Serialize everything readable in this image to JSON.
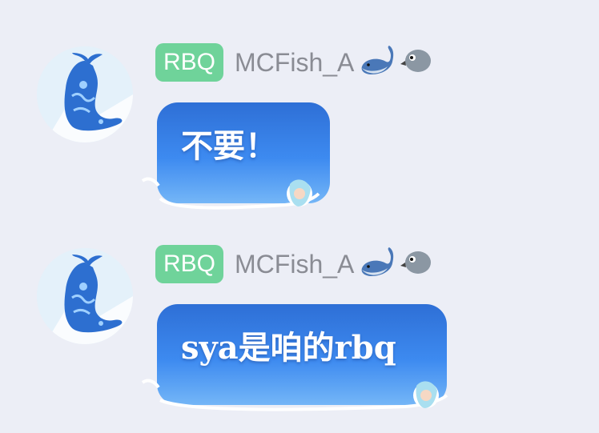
{
  "messages": [
    {
      "badge": "RBQ",
      "name": "MCFish_A",
      "text": "不要！"
    },
    {
      "badge": "RBQ",
      "name": "MCFish_A",
      "text": "sya是咱的rbq"
    }
  ],
  "icons": [
    "whale-avatar-icon",
    "whale-emoji-icon",
    "bird-head-emoji-icon",
    "mermaid-decoration-icon"
  ],
  "colors": {
    "background": "#eceef6",
    "badge": "#6fd39a",
    "bubble_top": "#2e6fd6",
    "bubble_bottom": "#74b6f7",
    "nickname": "#8a8c94"
  }
}
